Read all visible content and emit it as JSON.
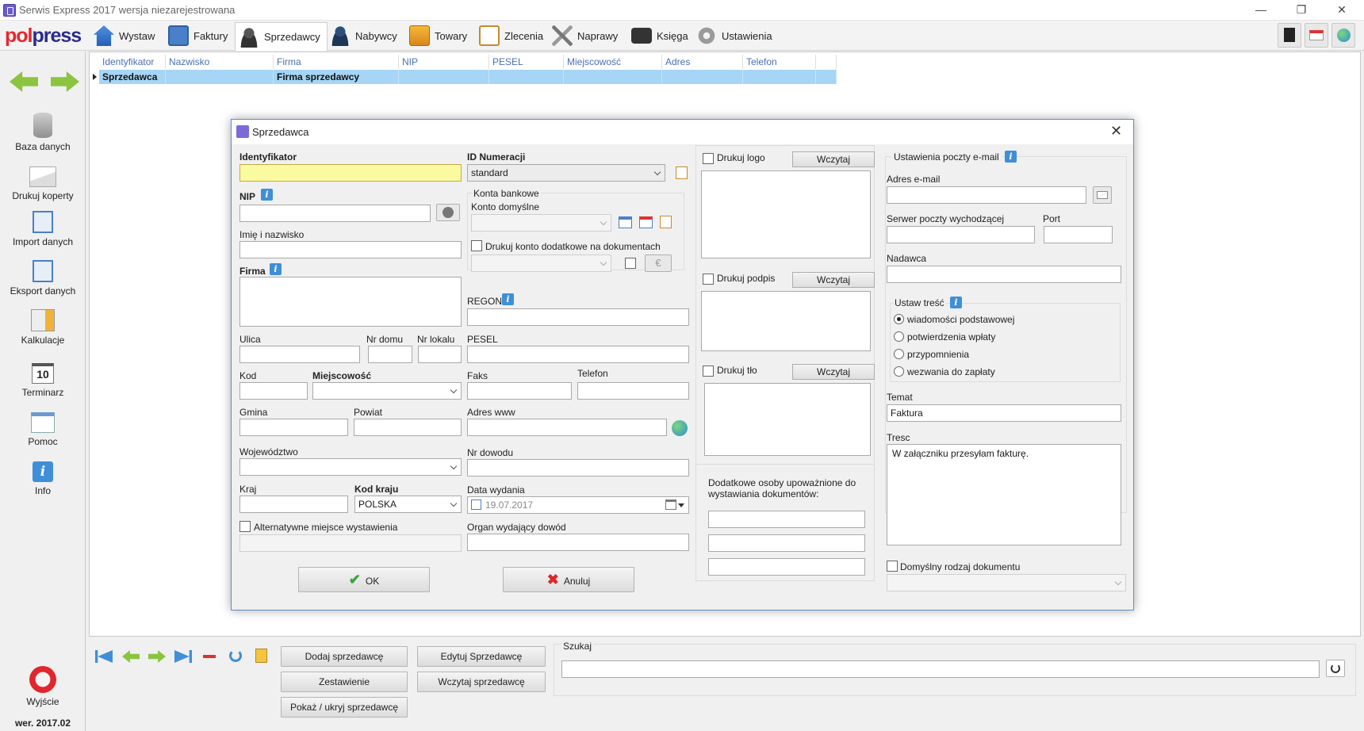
{
  "window": {
    "title": "Serwis Express 2017 wersja niezarejestrowana",
    "minimize": "—",
    "restore": "❐",
    "close": "✕"
  },
  "toolbar": {
    "logo_a": "pol",
    "logo_b": "press",
    "tabs": [
      {
        "label": "Wystaw",
        "icon": "home-icon"
      },
      {
        "label": "Faktury",
        "icon": "invoice-icon"
      },
      {
        "label": "Sprzedawcy",
        "icon": "seller-icon"
      },
      {
        "label": "Nabywcy",
        "icon": "buyer-icon"
      },
      {
        "label": "Towary",
        "icon": "goods-icon"
      },
      {
        "label": "Zlecenia",
        "icon": "orders-icon"
      },
      {
        "label": "Naprawy",
        "icon": "repair-icon"
      },
      {
        "label": "Księga",
        "icon": "ledger-icon"
      },
      {
        "label": "Ustawienia",
        "icon": "settings-icon"
      }
    ],
    "active_tab": "Sprzedawcy"
  },
  "sidebar": {
    "items": [
      {
        "label": "Baza danych",
        "icon": "database-icon"
      },
      {
        "label": "Drukuj koperty",
        "icon": "envelope-icon"
      },
      {
        "label": "Import danych",
        "icon": "import-icon"
      },
      {
        "label": "Eksport danych",
        "icon": "export-icon"
      },
      {
        "label": "Kalkulacje",
        "icon": "calculator-icon"
      },
      {
        "label": "Terminarz",
        "icon": "calendar-icon",
        "day": "10"
      },
      {
        "label": "Pomoc",
        "icon": "help-icon"
      },
      {
        "label": "Info",
        "icon": "info-icon"
      }
    ],
    "exit_label": "Wyjście",
    "version": "wer. 2017.02"
  },
  "grid": {
    "columns": [
      "Identyfikator",
      "Nazwisko",
      "Firma",
      "NIP",
      "PESEL",
      "Miejscowość",
      "Adres",
      "Telefon"
    ],
    "rows": [
      [
        "Sprzedawca",
        "",
        "Firma sprzedawcy",
        "",
        "",
        "",
        "",
        ""
      ]
    ]
  },
  "bottom": {
    "buttons": {
      "add": "Dodaj sprzedawcę",
      "edit": "Edytuj Sprzedawcę",
      "save": "Zestawienie",
      "load": "Wczytaj sprzedawcę",
      "toggle": "Pokaż / ukryj sprzedawcę"
    },
    "search_label": "Szukaj",
    "search_value": ""
  },
  "dialog": {
    "title": "Sprzedawca",
    "fields": {
      "identyfikator": {
        "label": "Identyfikator",
        "value": ""
      },
      "nip": {
        "label": "NIP",
        "value": ""
      },
      "imie": {
        "label": "Imię i nazwisko",
        "value": ""
      },
      "firma": {
        "label": "Firma",
        "value": ""
      },
      "ulica": {
        "label": "Ulica",
        "value": ""
      },
      "nr_domu": {
        "label": "Nr domu",
        "value": ""
      },
      "nr_lokalu": {
        "label": "Nr lokalu",
        "value": ""
      },
      "kod": {
        "label": "Kod",
        "value": ""
      },
      "miejscowosc": {
        "label": "Miejscowość",
        "value": ""
      },
      "gmina": {
        "label": "Gmina",
        "value": ""
      },
      "powiat": {
        "label": "Powiat",
        "value": ""
      },
      "wojewodztwo": {
        "label": "Województwo",
        "value": ""
      },
      "kraj": {
        "label": "Kraj",
        "value": ""
      },
      "kod_kraju": {
        "label": "Kod kraju",
        "value": "POLSKA"
      },
      "alt_miejsce": {
        "label": "Alternatywne miejsce wystawienia",
        "value": ""
      },
      "id_numeracji": {
        "label": "ID Numeracji",
        "value": "standard"
      },
      "konta_bankowe": "Konta bankowe",
      "konto_domyslne": {
        "label": "Konto domyślne",
        "value": ""
      },
      "drukuj_konto": "Drukuj konto dodatkowe na dokumentach",
      "euro": "€",
      "regon": {
        "label": "REGON",
        "value": ""
      },
      "pesel": {
        "label": "PESEL",
        "value": ""
      },
      "faks": {
        "label": "Faks",
        "value": ""
      },
      "telefon": {
        "label": "Telefon",
        "value": ""
      },
      "adres_www": {
        "label": "Adres www",
        "value": ""
      },
      "nr_dowodu": {
        "label": "Nr dowodu",
        "value": ""
      },
      "data_wydania": {
        "label": "Data wydania",
        "value": "19.07.2017"
      },
      "organ": {
        "label": "Organ wydający dowód",
        "value": ""
      }
    },
    "images": {
      "logo": "Drukuj logo",
      "podpis": "Drukuj podpis",
      "tlo": "Drukuj tło",
      "load_label": "Wczytaj",
      "extra_persons": "Dodatkowe osoby upoważnione do wystawiania dokumentów:"
    },
    "email": {
      "group": "Ustawienia poczty e-mail",
      "address_label": "Adres e-mail",
      "address_value": "",
      "smtp_label": "Serwer poczty wychodzącej",
      "smtp_value": "",
      "port_label": "Port",
      "port_value": "",
      "sender_label": "Nadawca",
      "sender_value": "",
      "content_group": "Ustaw treść",
      "options": [
        "wiadomości podstawowej",
        "potwierdzenia wpłaty",
        "przypomnienia",
        "wezwania do zapłaty"
      ],
      "selected_option": "wiadomości podstawowej",
      "subject_label": "Temat",
      "subject_value": "Faktura",
      "body_label": "Tresc",
      "body_value": "W załączniku przesyłam fakturę.",
      "default_doc_label": "Domyślny rodzaj dokumentu",
      "default_doc_value": ""
    },
    "ok_label": "OK",
    "cancel_label": "Anuluj"
  },
  "colors": {
    "accent": "#3f8fd8",
    "selected_row": "#a6d5f5",
    "header_text": "#4a6fb5",
    "identyfikator_bg": "#fafaa0",
    "ok_check": "#3aa33a",
    "cancel_x": "#d92a2a"
  }
}
